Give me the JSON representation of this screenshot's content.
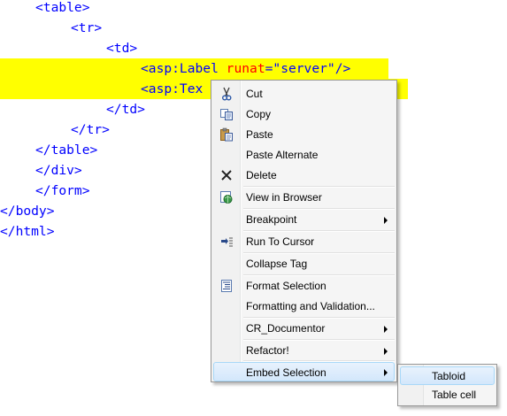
{
  "code": {
    "line1": "<table>",
    "line2": "<tr>",
    "line3": "<td>",
    "line4_tag": "<asp:Label",
    "line4_attr": "runat",
    "line4_eq": "=",
    "line4_val": "\"server\"",
    "line4_end": "/>",
    "line5": "<asp:Tex",
    "line6": "</td>",
    "line7": "</tr>",
    "line8": "</table>",
    "line9": "</div>",
    "line10": "</form>",
    "line11": "</body>",
    "line12": "</html>"
  },
  "context_menu": {
    "items": [
      {
        "label": "Cut",
        "icon": "scissors-icon"
      },
      {
        "label": "Copy",
        "icon": "copy-icon"
      },
      {
        "label": "Paste",
        "icon": "paste-icon"
      },
      {
        "label": "Paste Alternate",
        "icon": ""
      },
      {
        "label": "Delete",
        "icon": "delete-icon"
      },
      {
        "label": "View in Browser",
        "icon": "browser-icon"
      },
      {
        "label": "Breakpoint",
        "icon": ""
      },
      {
        "label": "Run To Cursor",
        "icon": "run-to-cursor-icon"
      },
      {
        "label": "Collapse Tag",
        "icon": ""
      },
      {
        "label": "Format Selection",
        "icon": "format-icon"
      },
      {
        "label": "Formatting and Validation...",
        "icon": ""
      },
      {
        "label": "CR_Documentor",
        "icon": ""
      },
      {
        "label": "Refactor!",
        "icon": ""
      },
      {
        "label": "Embed Selection",
        "icon": ""
      }
    ]
  },
  "submenu": {
    "items": [
      {
        "label": "Tabloid"
      },
      {
        "label": "Table cell"
      }
    ]
  }
}
